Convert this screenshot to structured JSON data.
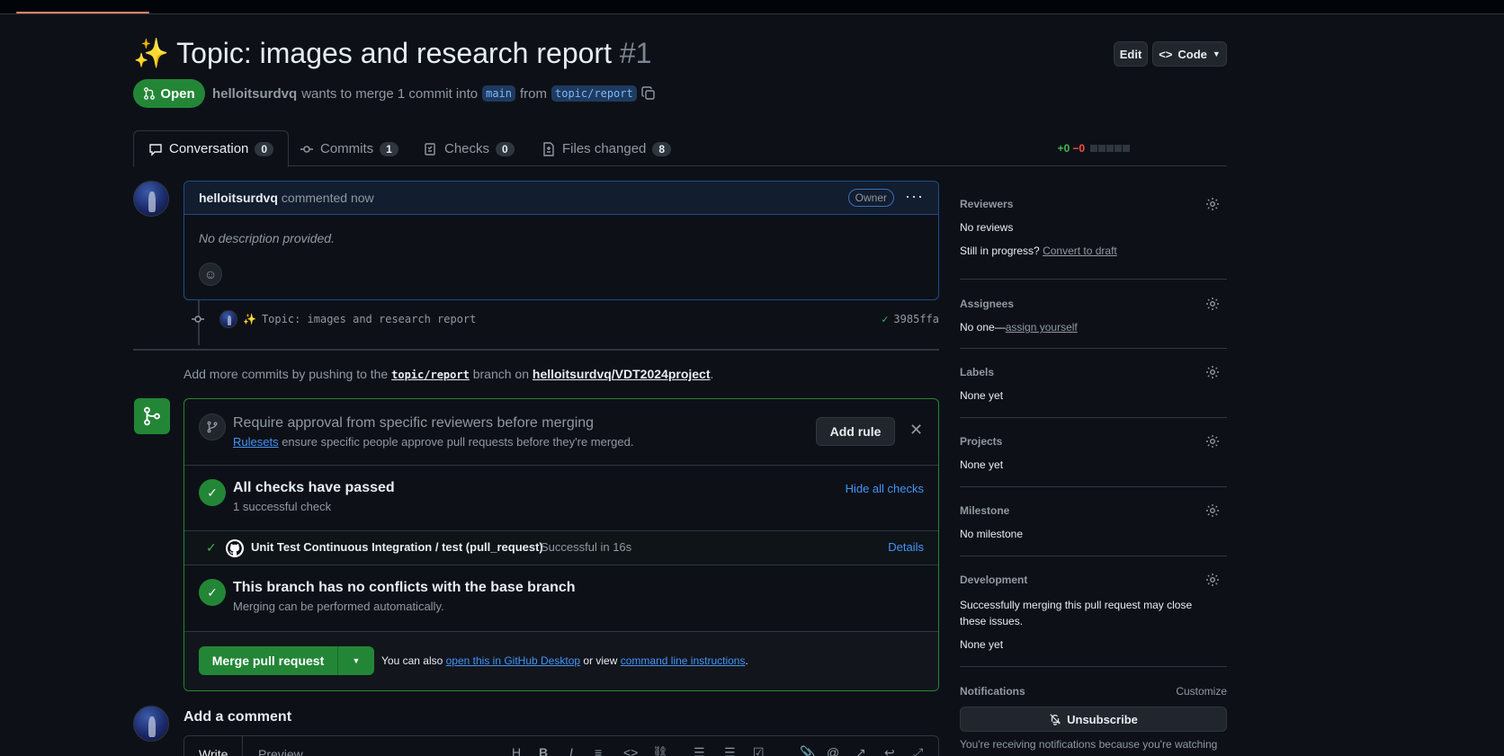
{
  "header": {
    "emoji": "✨",
    "title": "Topic: images and research report",
    "number": "#1",
    "edit_label": "Edit",
    "code_label": "Code"
  },
  "status": {
    "state": "Open",
    "author": "helloitsurdvq",
    "text_before": "wants to merge 1 commit into",
    "base_branch": "main",
    "from_word": "from",
    "head_branch": "topic/report"
  },
  "tabs": [
    {
      "label": "Conversation",
      "count": "0"
    },
    {
      "label": "Commits",
      "count": "1"
    },
    {
      "label": "Checks",
      "count": "0"
    },
    {
      "label": "Files changed",
      "count": "8"
    }
  ],
  "diffstat": {
    "additions": "+0",
    "deletions": "−0"
  },
  "comment": {
    "author": "helloitsurdvq",
    "time": "commented now",
    "role": "Owner",
    "body": "No description provided."
  },
  "commit": {
    "emoji": "✨",
    "message": "Topic: images and research report",
    "sha": "3985ffa"
  },
  "add_more": {
    "prefix": "Add more commits by pushing to the",
    "branch": "topic/report",
    "middle": "branch on",
    "repo": "helloitsurdvq/VDT2024project",
    "suffix": "."
  },
  "mergebox": {
    "rule_title": "Require approval from specific reviewers before merging",
    "rule_link": "Rulesets",
    "rule_text": "ensure specific people approve pull requests before they're merged.",
    "add_rule": "Add rule",
    "checks_title": "All checks have passed",
    "checks_sub": "1 successful check",
    "hide_checks": "Hide all checks",
    "check_name": "Unit Test Continuous Integration / test (pull_request)",
    "check_status": "Successful in 16s",
    "details": "Details",
    "conflict_title": "This branch has no conflicts with the base branch",
    "conflict_sub": "Merging can be performed automatically.",
    "merge_button": "Merge pull request",
    "also_text": "You can also",
    "desktop_link": "open this in GitHub Desktop",
    "or_view": "or view",
    "cli_link": "command line instructions",
    "period": "."
  },
  "add_comment": {
    "title": "Add a comment",
    "write": "Write",
    "preview": "Preview"
  },
  "sidebar": {
    "reviewers": {
      "title": "Reviewers",
      "value": "No reviews",
      "draft_prefix": "Still in progress?",
      "draft_link": "Convert to draft"
    },
    "assignees": {
      "title": "Assignees",
      "value": "No one—",
      "link": "assign yourself"
    },
    "labels": {
      "title": "Labels",
      "value": "None yet"
    },
    "projects": {
      "title": "Projects",
      "value": "None yet"
    },
    "milestone": {
      "title": "Milestone",
      "value": "No milestone"
    },
    "development": {
      "title": "Development",
      "text": "Successfully merging this pull request may close these issues.",
      "value": "None yet"
    },
    "notifications": {
      "title": "Notifications",
      "customize": "Customize",
      "unsubscribe": "Unsubscribe",
      "reason": "You're receiving notifications because you're watching"
    }
  },
  "colors": {
    "accent": "#4493f8",
    "success": "#238636",
    "danger": "#f85149",
    "bg": "#0d1117"
  }
}
